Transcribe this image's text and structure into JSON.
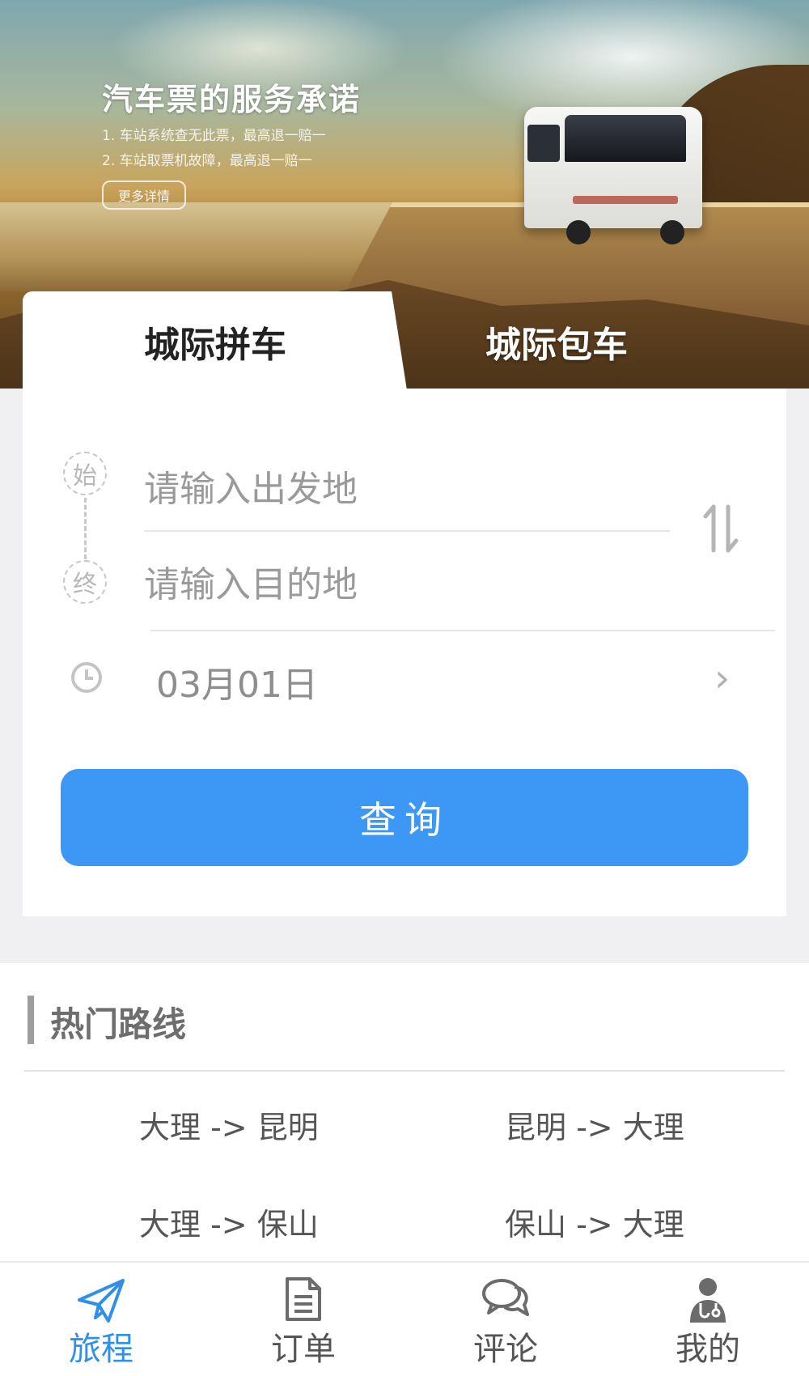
{
  "banner": {
    "title": "汽车票的服务承诺",
    "lines": [
      "1. 车站系统查无此票，最高退一赔一",
      "2. 车站取票机故障，最高退一赔一"
    ],
    "more_label": "更多详情"
  },
  "tabs": [
    {
      "label": "城际拼车",
      "active": true
    },
    {
      "label": "城际包车",
      "active": false
    }
  ],
  "search": {
    "start_icon_label": "始",
    "end_icon_label": "终",
    "from_placeholder": "请输入出发地",
    "to_placeholder": "请输入目的地",
    "date": "03月01日",
    "query_label": "查询"
  },
  "hot_routes": {
    "title": "热门路线",
    "items": [
      "大理 -> 昆明",
      "昆明 -> 大理",
      "大理 -> 保山",
      "保山 -> 大理"
    ]
  },
  "nav": {
    "items": [
      {
        "label": "旅程",
        "icon": "paper-plane-icon",
        "active": true
      },
      {
        "label": "订单",
        "icon": "document-icon",
        "active": false
      },
      {
        "label": "评论",
        "icon": "chat-bubbles-icon",
        "active": false
      },
      {
        "label": "我的",
        "icon": "doctor-person-icon",
        "active": false
      }
    ]
  },
  "colors": {
    "accent": "#3d97f5",
    "active_nav": "#2f8fe9",
    "placeholder": "#9a9a9a"
  }
}
